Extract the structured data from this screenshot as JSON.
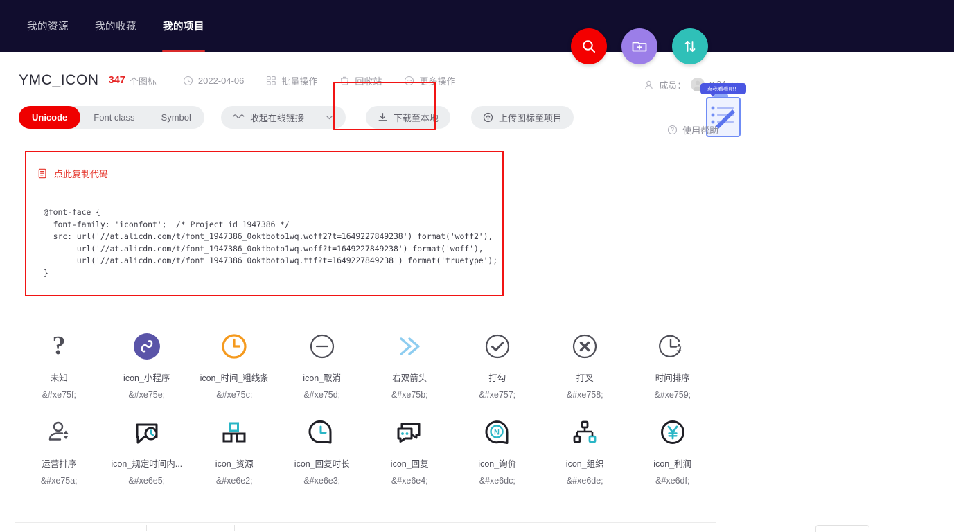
{
  "navbar": {
    "tabs": [
      {
        "label": "我的资源",
        "active": false
      },
      {
        "label": "我的收藏",
        "active": false
      },
      {
        "label": "我的项目",
        "active": true
      }
    ],
    "fabs": [
      {
        "name": "search-fab",
        "icon": "search-icon",
        "color": "#f40000"
      },
      {
        "name": "new-project-fab",
        "icon": "folder-add-icon",
        "color": "#9b7ee8"
      },
      {
        "name": "sort-fab",
        "icon": "sort-updown-icon",
        "color": "#2fc0b8"
      }
    ]
  },
  "project": {
    "title": "YMC_ICON",
    "count": "347",
    "count_unit": "个图标",
    "date": "2022-04-06",
    "batch_label": "批量操作",
    "recycle_label": "回收站",
    "more_label": "更多操作"
  },
  "members": {
    "label": "成员：",
    "count": "x 34"
  },
  "survey": {
    "bubble_text": "点我看看吧！"
  },
  "actions": {
    "segments": [
      {
        "label": "Unicode",
        "active": true
      },
      {
        "label": "Font class",
        "active": false
      },
      {
        "label": "Symbol",
        "active": false
      }
    ],
    "collapse_link_label": "收起在线链接",
    "download_label": "下载至本地",
    "upload_label": "上传图标至项目",
    "help_label": "使用帮助"
  },
  "code_panel": {
    "copy_label": "点此复制代码",
    "code": "@font-face {\n  font-family: 'iconfont';  /* Project id 1947386 */\n  src: url('//at.alicdn.com/t/font_1947386_0oktboto1wq.woff2?t=1649227849238') format('woff2'),\n       url('//at.alicdn.com/t/font_1947386_0oktboto1wq.woff?t=1649227849238') format('woff'),\n       url('//at.alicdn.com/t/font_1947386_0oktboto1wq.ttf?t=1649227849238') format('truetype');\n}"
  },
  "icons": [
    {
      "name": "未知",
      "code": "&#xe75f;",
      "art": "question-mark"
    },
    {
      "name": "icon_小程序",
      "code": "&#xe75e;",
      "art": "miniprogram"
    },
    {
      "name": "icon_时间_粗线条",
      "code": "&#xe75c;",
      "art": "clock-orange"
    },
    {
      "name": "icon_取消",
      "code": "&#xe75d;",
      "art": "minus-circle"
    },
    {
      "name": "右双箭头",
      "code": "&#xe75b;",
      "art": "double-chevron-right"
    },
    {
      "name": "打勾",
      "code": "&#xe757;",
      "art": "check-circle"
    },
    {
      "name": "打叉",
      "code": "&#xe758;",
      "art": "x-circle"
    },
    {
      "name": "时间排序",
      "code": "&#xe759;",
      "art": "clock-sort"
    },
    {
      "name": "运营排序",
      "code": "&#xe75a;",
      "art": "person-sort"
    },
    {
      "name": "icon_规定时间内...",
      "code": "&#xe6e5;",
      "art": "bubble-clock"
    },
    {
      "name": "icon_资源",
      "code": "&#xe6e2;",
      "art": "blocks"
    },
    {
      "name": "icon_回复时长",
      "code": "&#xe6e3;",
      "art": "clock-bubble"
    },
    {
      "name": "icon_回复",
      "code": "&#xe6e4;",
      "art": "chat-dots"
    },
    {
      "name": "icon_询价",
      "code": "&#xe6dc;",
      "art": "bubble-n"
    },
    {
      "name": "icon_组织",
      "code": "&#xe6de;",
      "art": "org-tree"
    },
    {
      "name": "icon_利润",
      "code": "&#xe6df;",
      "art": "yuan-circle"
    }
  ],
  "colors": {
    "navbar_bg": "#110d2e",
    "accent_red": "#ef0000",
    "highlight_red": "#f11414",
    "teal": "#2ab6c6",
    "orange": "#f59a1e",
    "blue_light": "#8ecdf0",
    "purple": "#5a54a8"
  }
}
